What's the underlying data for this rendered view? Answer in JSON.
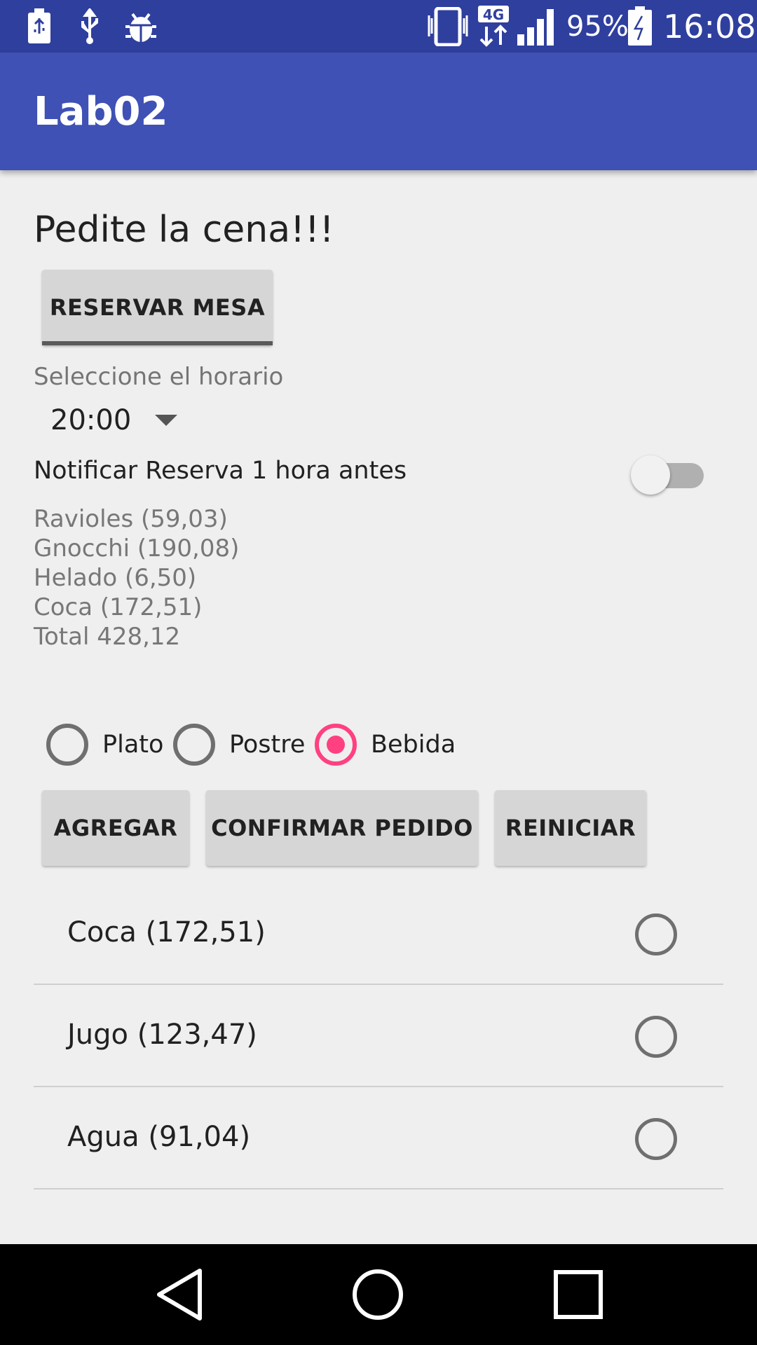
{
  "status_bar": {
    "battery_percent": "95%",
    "time": "16:08",
    "network": "4G",
    "icons": [
      "usb-storage-icon",
      "usb-icon",
      "debug-bug-icon",
      "vibrate-icon",
      "4g-icon",
      "signal-icon",
      "battery-charging-icon"
    ]
  },
  "app_bar": {
    "title": "Lab02"
  },
  "main": {
    "heading": "Pedite la cena!!!",
    "reservar_button": "RESERVAR MESA",
    "horario_label": "Seleccione el horario",
    "horario_value": "20:00",
    "notificar_label": "Notificar Reserva 1 hora antes",
    "notificar_on": false,
    "order_lines": [
      "Ravioles (59,03)",
      "Gnocchi (190,08)",
      "Helado (6,50)",
      "Coca (172,51)",
      "Total 428,12"
    ],
    "categories": [
      {
        "label": "Plato",
        "checked": false
      },
      {
        "label": "Postre",
        "checked": false
      },
      {
        "label": "Bebida",
        "checked": true
      }
    ],
    "buttons": {
      "agregar": "AGREGAR",
      "confirmar": "CONFIRMAR PEDIDO",
      "reiniciar": "REINICIAR"
    },
    "items": [
      {
        "label": "Coca (172,51)",
        "checked": false
      },
      {
        "label": "Jugo (123,47)",
        "checked": false
      },
      {
        "label": "Agua (91,04)",
        "checked": false
      }
    ]
  },
  "colors": {
    "status_bar": "#2f3f9e",
    "app_bar": "#3f51b5",
    "accent": "#ff4081",
    "background": "#efefef"
  },
  "nav_bar": {
    "icons": [
      "back-icon",
      "home-icon",
      "recents-icon"
    ]
  }
}
